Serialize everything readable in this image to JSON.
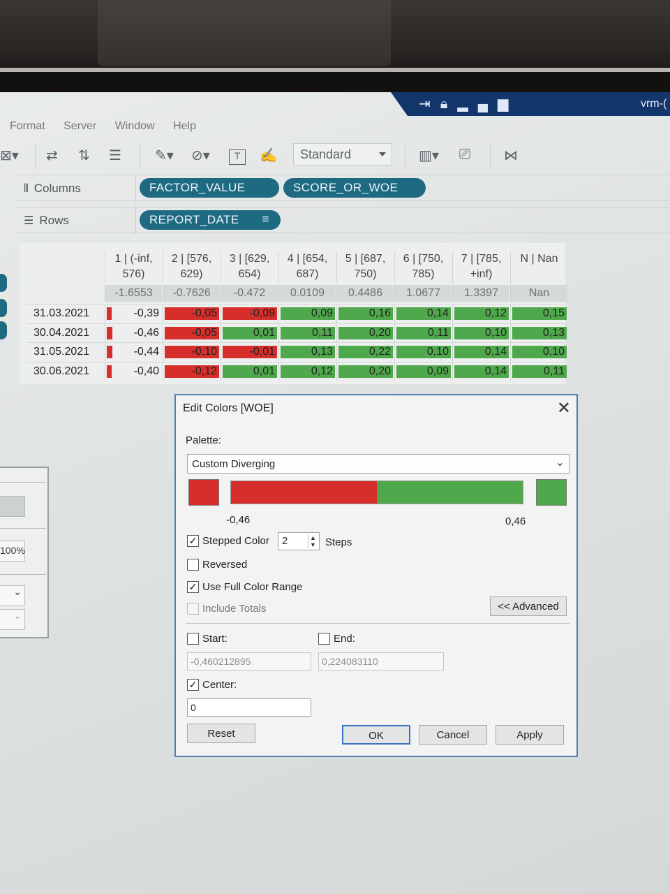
{
  "window": {
    "title_fragment": "vrm-("
  },
  "menu": [
    "Format",
    "Server",
    "Window",
    "Help"
  ],
  "toolbar": {
    "mark_type": "Standard"
  },
  "shelves": {
    "columns_label": "Columns",
    "rows_label": "Rows",
    "columns_pills": [
      "FACTOR_VALUE",
      "SCORE_OR_WOE"
    ],
    "rows_pills": [
      "REPORT_DATE"
    ]
  },
  "table": {
    "columns": [
      {
        "l1": "1 | (-inf,",
        "l2": "576)",
        "factor": "-1.6553"
      },
      {
        "l1": "2 | [576,",
        "l2": "629)",
        "factor": "-0.7626"
      },
      {
        "l1": "3 | [629,",
        "l2": "654)",
        "factor": "-0.472"
      },
      {
        "l1": "4 | [654,",
        "l2": "687)",
        "factor": "0.0109"
      },
      {
        "l1": "5 | [687,",
        "l2": "750)",
        "factor": "0.4486"
      },
      {
        "l1": "6 | [750,",
        "l2": "785)",
        "factor": "1.0677"
      },
      {
        "l1": "7 | [785,",
        "l2": "+inf)",
        "factor": "1.3397"
      },
      {
        "l1": "",
        "l2": "N | Nan",
        "factor": "Nan"
      }
    ],
    "rows": [
      {
        "date": "31.03.2021",
        "values": [
          "-0,39",
          "-0,05",
          "-0,09",
          "0,09",
          "0,16",
          "0,14",
          "0,12",
          "0,15"
        ],
        "nums": [
          -0.39,
          -0.05,
          -0.09,
          0.09,
          0.16,
          0.14,
          0.12,
          0.15
        ]
      },
      {
        "date": "30.04.2021",
        "values": [
          "-0,46",
          "-0,05",
          "0,01",
          "0,11",
          "0,20",
          "0,11",
          "0,10",
          "0,13"
        ],
        "nums": [
          -0.46,
          -0.05,
          0.01,
          0.11,
          0.2,
          0.11,
          0.1,
          0.13
        ]
      },
      {
        "date": "31.05.2021",
        "values": [
          "-0,44",
          "-0,10",
          "-0,01",
          "0,13",
          "0,22",
          "0,10",
          "0,14",
          "0,10"
        ],
        "nums": [
          -0.44,
          -0.1,
          -0.01,
          0.13,
          0.22,
          0.1,
          0.14,
          0.1
        ]
      },
      {
        "date": "30.06.2021",
        "values": [
          "-0,40",
          "-0,12",
          "0,01",
          "0,12",
          "0,20",
          "0,09",
          "0,14",
          "0,11"
        ],
        "nums": [
          -0.4,
          -0.12,
          0.01,
          0.12,
          0.2,
          0.09,
          0.14,
          0.11
        ]
      }
    ]
  },
  "left_panel": {
    "zoom": "100%"
  },
  "dialog": {
    "title": "Edit Colors [WOE]",
    "palette_label": "Palette:",
    "palette_value": "Custom Diverging",
    "range_min": "-0,46",
    "range_max": "0,46",
    "stepped_label": "Stepped Color",
    "stepped_checked": true,
    "steps_value": "2",
    "steps_label": "Steps",
    "reversed_label": "Reversed",
    "full_range_label": "Use Full Color Range",
    "include_totals_label": "Include Totals",
    "advanced_button": "<< Advanced",
    "start_label": "Start:",
    "start_value": "-0,460212895",
    "end_label": "End:",
    "end_value": "0,224083110",
    "center_label": "Center:",
    "center_value": "0",
    "reset_button": "Reset",
    "ok_button": "OK",
    "cancel_button": "Cancel",
    "apply_button": "Apply"
  },
  "colors": {
    "negative": "#d52e2b",
    "positive": "#4fa84b",
    "pill": "#1e6a83",
    "status_bar": "#12356b"
  }
}
